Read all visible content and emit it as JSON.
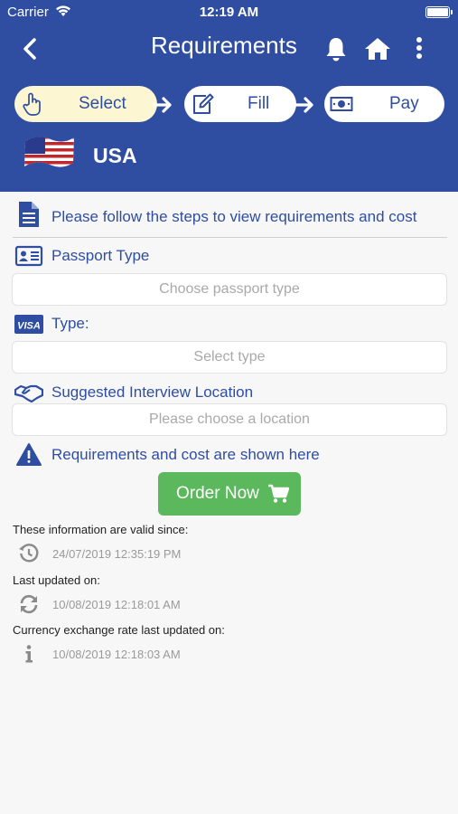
{
  "status_bar": {
    "carrier": "Carrier",
    "time": "12:19 AM"
  },
  "nav": {
    "title": "Requirements"
  },
  "steps": [
    {
      "label": "Select",
      "icon": "pointer-hand-icon",
      "active": true
    },
    {
      "label": "Fill",
      "icon": "edit-icon",
      "active": false
    },
    {
      "label": "Pay",
      "icon": "money-icon",
      "active": false
    }
  ],
  "country": {
    "name": "USA",
    "flag": "us-flag"
  },
  "instructions": "Please follow the steps to view requirements and cost",
  "passport": {
    "label": "Passport Type",
    "placeholder": "Choose passport type"
  },
  "visa_type": {
    "label": "Type:",
    "placeholder": "Select type",
    "icon_text": "VISA"
  },
  "location": {
    "label": "Suggested Interview Location",
    "placeholder": "Please choose a location"
  },
  "notice": "Requirements and cost are shown here",
  "order_button": "Order Now",
  "info": [
    {
      "label": "These information are valid since:",
      "value": "24/07/2019 12:35:19 PM",
      "icon": "history-icon"
    },
    {
      "label": "Last updated on:",
      "value": "10/08/2019 12:18:01 AM",
      "icon": "refresh-icon"
    },
    {
      "label": "Currency exchange rate last updated on:",
      "value": "10/08/2019 12:18:03 AM",
      "icon": "info-icon"
    }
  ],
  "colors": {
    "primary": "#2f4ea2",
    "active_step": "#fcf7d2",
    "order_button": "#5cb85c"
  }
}
